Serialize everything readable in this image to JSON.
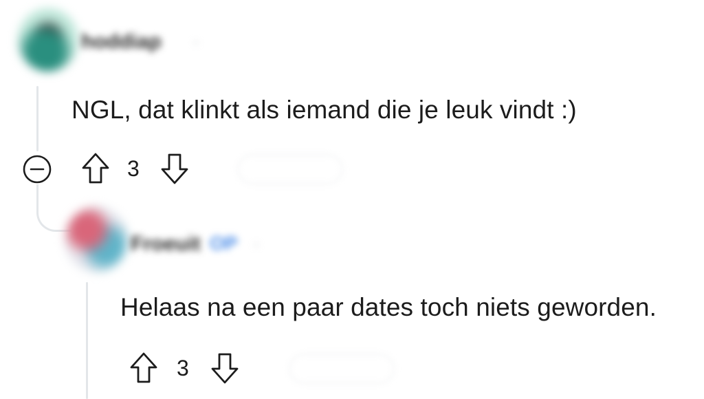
{
  "comments": [
    {
      "username": "hoddiap",
      "meta": "·",
      "body": "NGL, dat klinkt als iemand die je leuk vindt :)",
      "score": "3",
      "collapse_icon": "collapse-minus-icon",
      "upvote_icon": "arrow-up-icon",
      "downvote_icon": "arrow-down-icon"
    },
    {
      "username": "Froeuit",
      "op_badge": "OP",
      "meta": "·",
      "body": "Helaas na een paar dates toch niets geworden.",
      "score": "3",
      "upvote_icon": "arrow-up-icon",
      "downvote_icon": "arrow-down-icon"
    }
  ],
  "colors": {
    "text": "#1c1c1c",
    "thread_line": "#e3e6e9",
    "op_badge": "#4a8ce8"
  }
}
